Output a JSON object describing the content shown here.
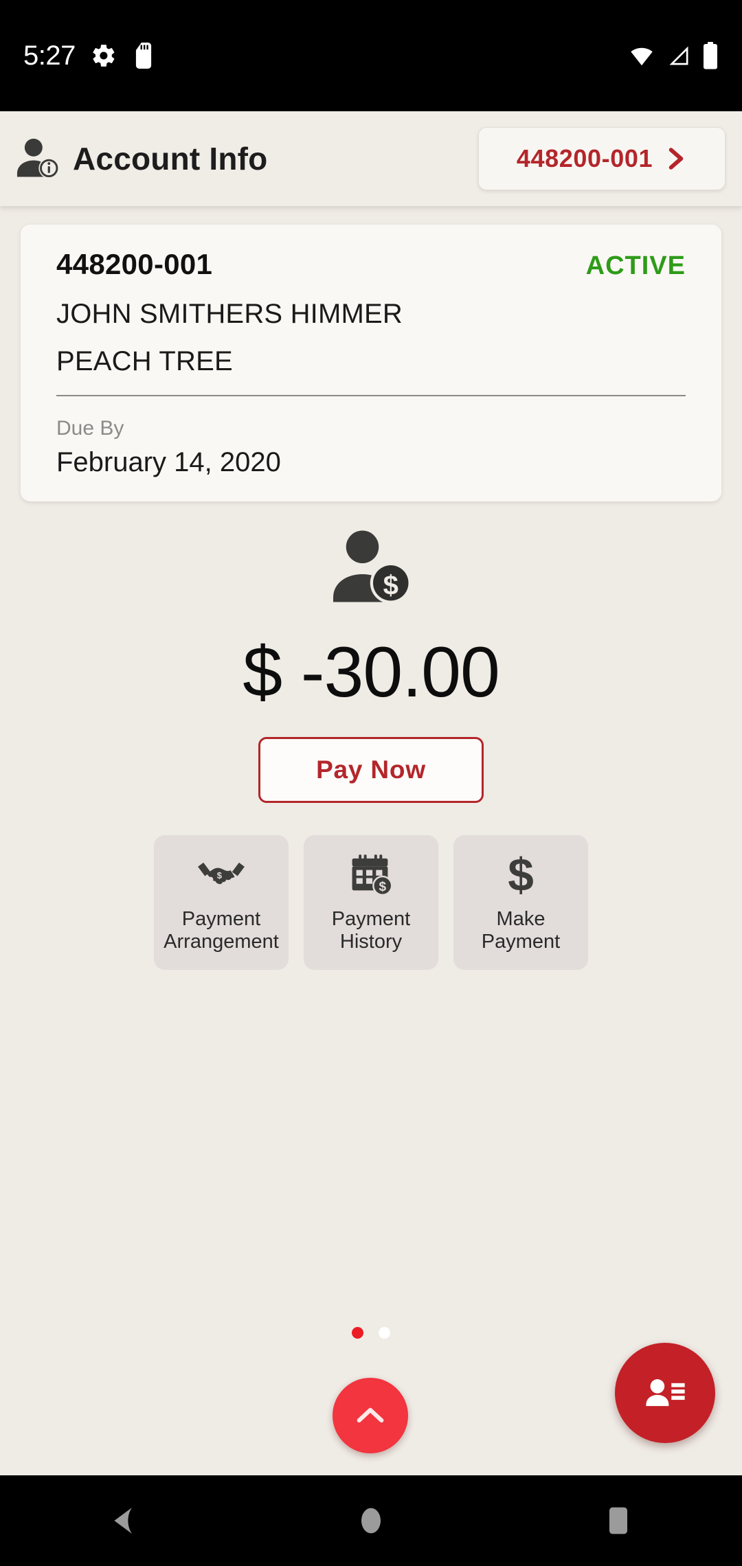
{
  "statusbar": {
    "time": "5:27",
    "left_icons": [
      "settings-gear-icon",
      "sd-card-icon"
    ],
    "right_icons": [
      "wifi-icon",
      "cellular-signal-icon",
      "battery-icon"
    ]
  },
  "appbar": {
    "icon": "account-info-icon",
    "title": "Account Info",
    "account_pill": {
      "label": "448200-001",
      "chevron": "chevron-right-icon"
    }
  },
  "account_card": {
    "account_number": "448200-001",
    "status": "ACTIVE",
    "status_color": "#2e9b19",
    "customer_name": "JOHN SMITHERS HIMMER",
    "service_name": "PEACH TREE",
    "due_by_label": "Due By",
    "due_by_value": "February 14, 2020"
  },
  "balance": {
    "icon": "person-dollar-icon",
    "currency_symbol": "$",
    "amount": "-30.00",
    "display": "$ -30.00",
    "pay_now_label": "Pay Now",
    "accent_color": "#b3262b"
  },
  "tiles": [
    {
      "icon": "handshake-dollar-icon",
      "line1": "Payment",
      "line2": "Arrangement"
    },
    {
      "icon": "calendar-dollar-icon",
      "line1": "Payment",
      "line2": "History"
    },
    {
      "icon": "dollar-sign-icon",
      "line1": "Make",
      "line2": "Payment"
    }
  ],
  "pager": {
    "total": 2,
    "active_index": 0,
    "active_color": "#eb1c24",
    "inactive_color": "#ffffff"
  },
  "fabs": {
    "scroll_up": {
      "icon": "chevron-up-icon",
      "color": "#f2353e"
    },
    "contacts": {
      "icon": "contact-card-icon",
      "color": "#c32127"
    }
  },
  "navbar": {
    "back": "back-triangle-icon",
    "home": "home-circle-icon",
    "recents": "recents-square-icon"
  }
}
